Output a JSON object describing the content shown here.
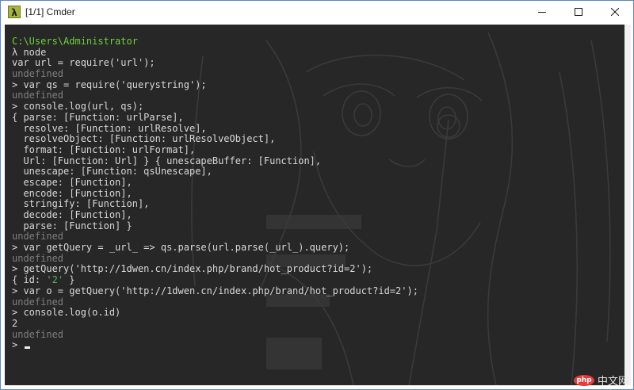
{
  "window": {
    "title": "[1/1] Cmder",
    "icon": "lambda-icon",
    "controls": [
      "minimize-icon",
      "maximize-icon",
      "close-icon"
    ]
  },
  "colors": {
    "console_bg": "#272727",
    "path": "#6fcf3e",
    "undefined": "#7e7e7e",
    "string": "#57b26b",
    "number": "#d7c24e",
    "text": "#d9d9d9"
  },
  "console": {
    "lines": [
      {
        "segments": [
          {
            "text": "C:\\Users\\Administrator",
            "style": "path"
          }
        ]
      },
      {
        "segments": [
          {
            "text": "λ node",
            "style": "text"
          }
        ]
      },
      {
        "segments": [
          {
            "text": "var url = require('url');",
            "style": "text"
          }
        ]
      },
      {
        "segments": [
          {
            "text": "undefined",
            "style": "undef"
          }
        ]
      },
      {
        "segments": [
          {
            "text": "> var qs = require('querystring');",
            "style": "text"
          }
        ]
      },
      {
        "segments": [
          {
            "text": "undefined",
            "style": "undef"
          }
        ]
      },
      {
        "segments": [
          {
            "text": "> console.log(url, qs);",
            "style": "text"
          }
        ]
      },
      {
        "segments": [
          {
            "text": "{ parse: [Function: urlParse],",
            "style": "text"
          }
        ]
      },
      {
        "segments": [
          {
            "text": "  resolve: [Function: urlResolve],",
            "style": "text"
          }
        ]
      },
      {
        "segments": [
          {
            "text": "  resolveObject: [Function: urlResolveObject],",
            "style": "text"
          }
        ]
      },
      {
        "segments": [
          {
            "text": "  format: [Function: urlFormat],",
            "style": "text"
          }
        ]
      },
      {
        "segments": [
          {
            "text": "  Url: [Function: Url] } { unescapeBuffer: [Function],",
            "style": "text"
          }
        ]
      },
      {
        "segments": [
          {
            "text": "  unescape: [Function: qsUnescape],",
            "style": "text"
          }
        ]
      },
      {
        "segments": [
          {
            "text": "  escape: [Function],",
            "style": "text"
          }
        ]
      },
      {
        "segments": [
          {
            "text": "  encode: [Function],",
            "style": "text"
          }
        ]
      },
      {
        "segments": [
          {
            "text": "  stringify: [Function],",
            "style": "text"
          }
        ]
      },
      {
        "segments": [
          {
            "text": "  decode: [Function],",
            "style": "text"
          }
        ]
      },
      {
        "segments": [
          {
            "text": "  parse: [Function] }",
            "style": "text"
          }
        ]
      },
      {
        "segments": [
          {
            "text": "undefined",
            "style": "undef"
          }
        ]
      },
      {
        "segments": [
          {
            "text": "> var getQuery = _url_ => qs.parse(url.parse(_url_).query);",
            "style": "text"
          }
        ]
      },
      {
        "segments": [
          {
            "text": "undefined",
            "style": "undef"
          }
        ]
      },
      {
        "segments": [
          {
            "text": "> getQuery('http://1dwen.cn/index.php/brand/hot_product?id=2');",
            "style": "text"
          }
        ]
      },
      {
        "segments": [
          {
            "text": "{ id: ",
            "style": "text"
          },
          {
            "text": "'2'",
            "style": "str"
          },
          {
            "text": " }",
            "style": "text"
          }
        ]
      },
      {
        "segments": [
          {
            "text": "> var o = getQuery('http://1dwen.cn/index.php/brand/hot_product?id=2');",
            "style": "text"
          }
        ]
      },
      {
        "segments": [
          {
            "text": "undefined",
            "style": "undef"
          }
        ]
      },
      {
        "segments": [
          {
            "text": "> console.log(o.id)",
            "style": "text"
          }
        ]
      },
      {
        "segments": [
          {
            "text": "2",
            "style": "text"
          }
        ]
      },
      {
        "segments": [
          {
            "text": "undefined",
            "style": "undef"
          }
        ]
      },
      {
        "segments": [
          {
            "text": "> ",
            "style": "text"
          }
        ],
        "cursor": true
      }
    ]
  },
  "watermark": {
    "logo": "php",
    "text": "中文网"
  }
}
